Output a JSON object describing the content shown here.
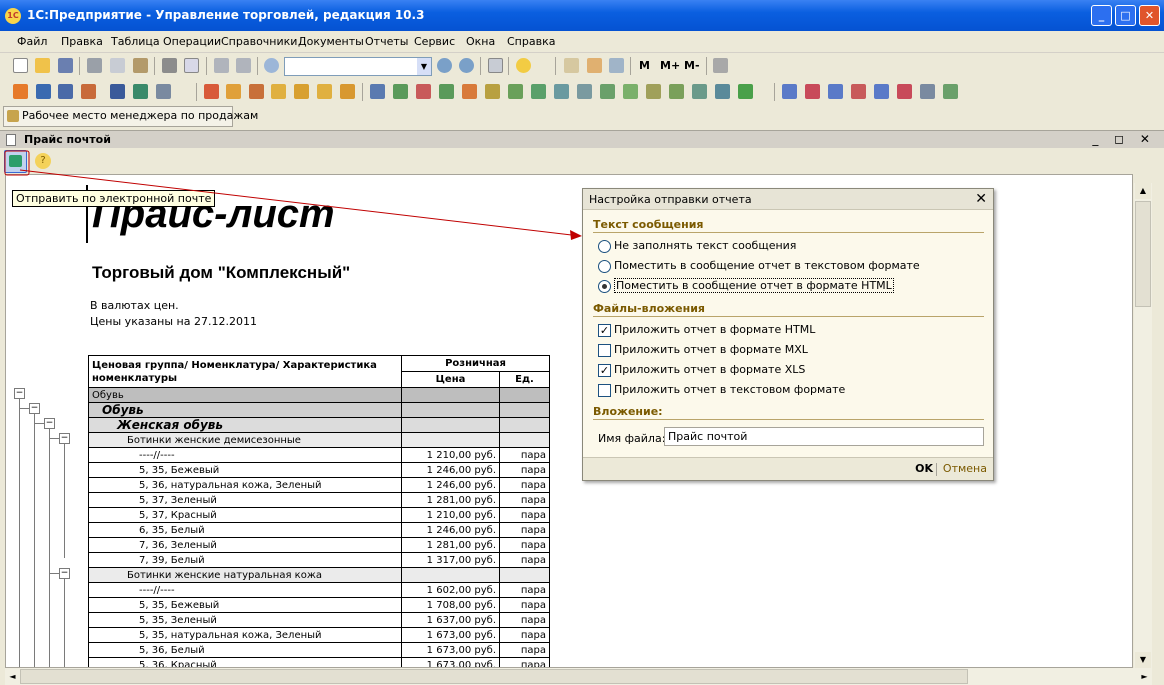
{
  "window": {
    "logo": "1С",
    "title": "1С:Предприятие - Управление торговлей, редакция 10.3",
    "controls": [
      "_",
      "□",
      "✕"
    ]
  },
  "menu": [
    "Файл",
    "Правка",
    "Таблица",
    "Операции",
    "Справочники",
    "Документы",
    "Отчеты",
    "Сервис",
    "Окна",
    "Справка"
  ],
  "toolbar1": {
    "m_label": "M",
    "mplus_label": "M+",
    "mminus_label": "M-"
  },
  "workplace_button": "Рабочее место менеджера по продажам",
  "doc_window": {
    "title": "Прайс почтой",
    "controls": "_ ◻ ✕",
    "tooltip": "Отправить по электронной почте",
    "help": "?"
  },
  "report": {
    "title": "Прайс-лист",
    "company": "Торговый дом \"Комплексный\"",
    "note1": "В валютах цен.",
    "note2": "Цены указаны на 27.12.2011",
    "header_group": "Ценовая группа/ Номенклатура/ Характеристика номенклатуры",
    "header_price_type": "Розничная",
    "header_price": "Цена",
    "header_unit": "Ед.",
    "rows": [
      {
        "level": 0,
        "name": "Обувь",
        "price": "",
        "unit": ""
      },
      {
        "level": 1,
        "name": "Обувь",
        "price": "",
        "unit": ""
      },
      {
        "level": 2,
        "name": "Женская обувь",
        "price": "",
        "unit": ""
      },
      {
        "level": 3,
        "name": "Ботинки женские демисезонные",
        "price": "",
        "unit": ""
      },
      {
        "level": 4,
        "name": "----//----",
        "price": "1 210,00 руб.",
        "unit": "пара"
      },
      {
        "level": 4,
        "name": "5, 35, Бежевый",
        "price": "1 246,00 руб.",
        "unit": "пара"
      },
      {
        "level": 4,
        "name": "5, 36, натуральная кожа, Зеленый",
        "price": "1 246,00 руб.",
        "unit": "пара"
      },
      {
        "level": 4,
        "name": "5, 37, Зеленый",
        "price": "1 281,00 руб.",
        "unit": "пара"
      },
      {
        "level": 4,
        "name": "5, 37, Красный",
        "price": "1 210,00 руб.",
        "unit": "пара"
      },
      {
        "level": 4,
        "name": "6, 35, Белый",
        "price": "1 246,00 руб.",
        "unit": "пара"
      },
      {
        "level": 4,
        "name": "7, 36, Зеленый",
        "price": "1 281,00 руб.",
        "unit": "пара"
      },
      {
        "level": 4,
        "name": "7, 39, Белый",
        "price": "1 317,00 руб.",
        "unit": "пара"
      },
      {
        "level": 3,
        "name": "Ботинки женские натуральная кожа",
        "price": "",
        "unit": ""
      },
      {
        "level": 4,
        "name": "----//----",
        "price": "1 602,00 руб.",
        "unit": "пара"
      },
      {
        "level": 4,
        "name": "5, 35, Бежевый",
        "price": "1 708,00 руб.",
        "unit": "пара"
      },
      {
        "level": 4,
        "name": "5, 35, Зеленый",
        "price": "1 637,00 руб.",
        "unit": "пара"
      },
      {
        "level": 4,
        "name": "5, 35, натуральная кожа, Зеленый",
        "price": "1 673,00 руб.",
        "unit": "пара"
      },
      {
        "level": 4,
        "name": "5, 36, Белый",
        "price": "1 673,00 руб.",
        "unit": "пара"
      },
      {
        "level": 4,
        "name": "5, 36, Красный",
        "price": "1 673,00 руб.",
        "unit": "пара"
      }
    ]
  },
  "dialog": {
    "title": "Настройка отправки отчета",
    "section_text": "Текст сообщения",
    "radio_options": [
      {
        "label": "Не заполнять текст сообщения",
        "selected": false
      },
      {
        "label": "Поместить в сообщение отчет в текстовом формате",
        "selected": false
      },
      {
        "label": "Поместить в сообщение отчет в формате HTML",
        "selected": true
      }
    ],
    "section_files": "Файлы-вложения",
    "checkbox_options": [
      {
        "label": "Приложить отчет в формате HTML",
        "checked": true
      },
      {
        "label": "Приложить отчет в формате MXL",
        "checked": false
      },
      {
        "label": "Приложить отчет в формате XLS",
        "checked": true
      },
      {
        "label": "Приложить отчет в текстовом формате",
        "checked": false
      }
    ],
    "section_attachment": "Вложение:",
    "filename_label": "Имя файла:",
    "filename_value": "Прайс почтой",
    "ok_label": "OK",
    "cancel_label": "Отмена"
  },
  "colors": {
    "titlebar": "#0a5fe0",
    "dialog_bg": "#fcf9eb",
    "section": "#7b5a00",
    "arrow": "#c00000"
  }
}
